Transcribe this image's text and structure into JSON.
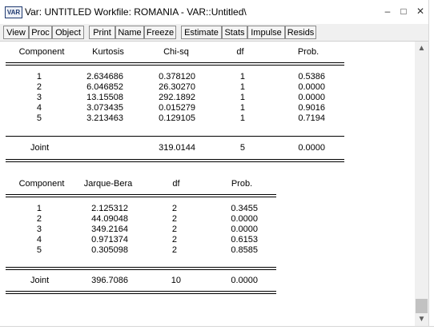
{
  "window": {
    "icon_text": "VAR",
    "title": "Var: UNTITLED   Workfile: ROMANIA - VAR::Untitled\\",
    "minimize_glyph": "–",
    "maximize_glyph": "□",
    "close_glyph": "✕"
  },
  "toolbar": {
    "buttons": [
      "View",
      "Proc",
      "Object",
      "Print",
      "Name",
      "Freeze",
      "Estimate",
      "Stats",
      "Impulse",
      "Resids"
    ]
  },
  "kurtosis_table": {
    "headers": [
      "Component",
      "Kurtosis",
      "Chi-sq",
      "df",
      "Prob."
    ],
    "rows": [
      [
        "1",
        "2.634686",
        "0.378120",
        "1",
        "0.5386"
      ],
      [
        "2",
        "6.046852",
        "26.30270",
        "1",
        "0.0000"
      ],
      [
        "3",
        "13.15508",
        "292.1892",
        "1",
        "0.0000"
      ],
      [
        "4",
        "3.073435",
        "0.015279",
        "1",
        "0.9016"
      ],
      [
        "5",
        "3.213463",
        "0.129105",
        "1",
        "0.7194"
      ]
    ],
    "joint": [
      "Joint",
      "",
      "319.0144",
      "5",
      "0.0000"
    ]
  },
  "jb_table": {
    "headers": [
      "Component",
      "Jarque-Bera",
      "df",
      "Prob."
    ],
    "rows": [
      [
        "1",
        "2.125312",
        "2",
        "0.3455"
      ],
      [
        "2",
        "44.09048",
        "2",
        "0.0000"
      ],
      [
        "3",
        "349.2164",
        "2",
        "0.0000"
      ],
      [
        "4",
        "0.971374",
        "2",
        "0.6153"
      ],
      [
        "5",
        "0.305098",
        "2",
        "0.8585"
      ]
    ],
    "joint": [
      "Joint",
      "396.7086",
      "10",
      "0.0000"
    ]
  },
  "scrollbar": {
    "up_glyph": "▲",
    "down_glyph": "▼"
  }
}
